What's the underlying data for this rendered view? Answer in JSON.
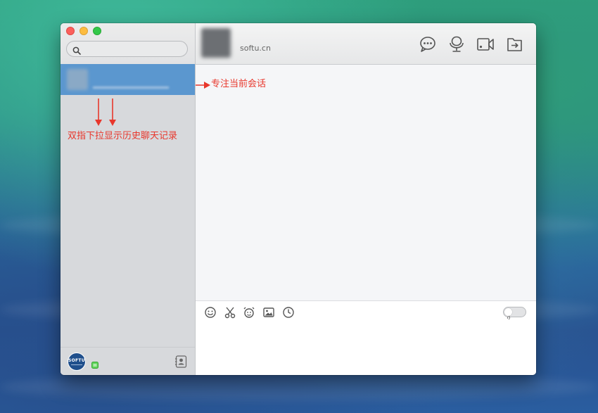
{
  "window": {
    "traffic_lights": [
      "close",
      "minimize",
      "maximize"
    ]
  },
  "sidebar": {
    "search": {
      "placeholder": "",
      "value": ""
    },
    "sessions": [
      {
        "name": "",
        "preview": "",
        "selected": true
      }
    ],
    "annotation": "双指下拉显示历史聊天记录",
    "footer": {
      "avatar_text": "SOFTU"
    }
  },
  "chat": {
    "contact": {
      "name": "",
      "subtitle": "softu.cn"
    },
    "toolbar": [
      "chat-bubble-icon",
      "voice-mic-icon",
      "video-camera-icon",
      "send-file-icon"
    ],
    "annotation": "专注当前会话",
    "compose_tools": [
      "emoji-icon",
      "screenshot-scissors-icon",
      "shake-icon",
      "image-icon",
      "history-clock-icon"
    ],
    "compose_value": ""
  },
  "colors": {
    "annotation": "#e8372c",
    "selected_session": "#5b97cf",
    "sidebar_bg": "#d7d9dc",
    "chat_bg": "#f5f6f8"
  }
}
